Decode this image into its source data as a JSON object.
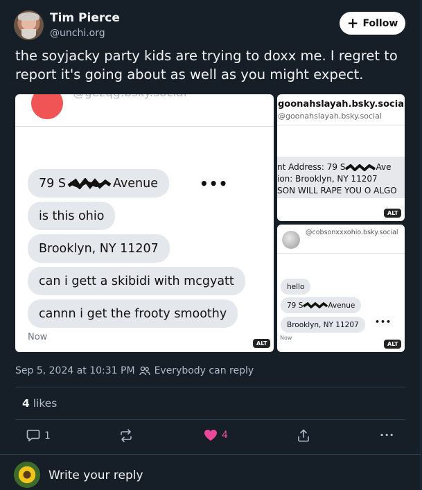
{
  "author": {
    "name": "Tim Pierce",
    "handle": "@unchi.org",
    "follow_label": "Follow"
  },
  "post": {
    "text": "the soyjacky party kids are trying to doxx me. I regret to report it's going about as well as you might expect."
  },
  "images": {
    "alt_label": "ALT",
    "img1": {
      "handle": "@gezqg.bsky.social",
      "bubbles": {
        "address_prefix": "79 S",
        "address_suffix": " Avenue",
        "b2": "is this ohio",
        "b3": "Brooklyn, NY 11207",
        "b4": "can i gett a skibidi with mcgyatt",
        "b5": "cannn i get the frooty smoothy"
      },
      "dots": "•••",
      "now": "Now"
    },
    "img2": {
      "title": "goonahslayah.bsky.social",
      "handle": "@goonahslayah.bsky.social",
      "row1_prefix": "nt Address:  79 S",
      "row1_suffix": "Ave",
      "row2": "ion:   Brooklyn, NY 11207",
      "row3": "SON WILL RAPE YOU O ALGO"
    },
    "img3": {
      "handle": "@cobsonxxxohio.bsky.social",
      "b1": "hello",
      "b2_prefix": "79 S",
      "b2_suffix": "Avenue",
      "b3": "Brooklyn, NY 11207",
      "dots": "•••",
      "now": "Now"
    }
  },
  "meta": {
    "timestamp": "Sep 5, 2024 at 10:31 PM",
    "reply_setting": "Everybody can reply"
  },
  "stats": {
    "likes_count": "4",
    "likes_label": "likes"
  },
  "actions": {
    "reply_count": "1",
    "like_count": "4"
  },
  "composer": {
    "placeholder": "Write your reply"
  },
  "colors": {
    "background": "#161e27",
    "like_pink": "#ec4899",
    "muted": "#aebbc9"
  }
}
